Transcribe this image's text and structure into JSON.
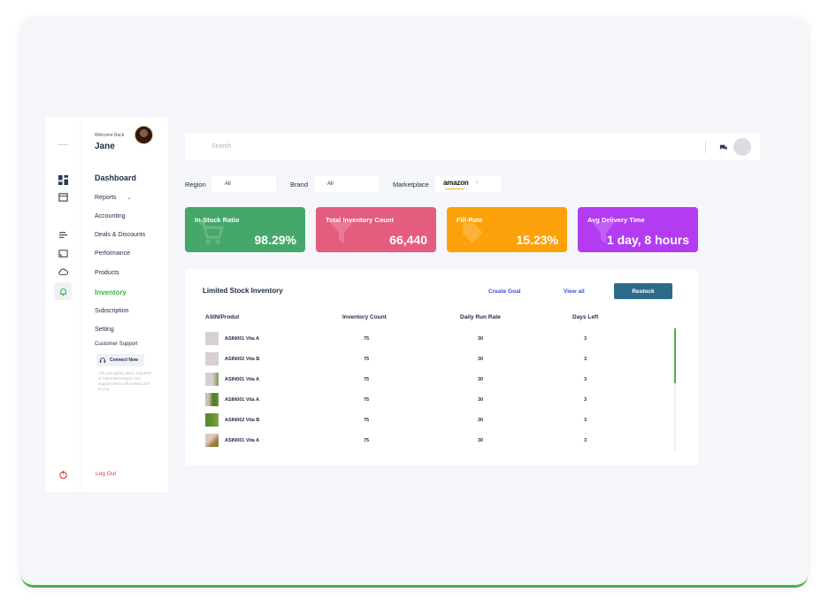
{
  "sidebar": {
    "welcome_text": "Welcome Back",
    "user_name": "Jane",
    "nav": {
      "dashboard": "Dashboard",
      "reports": "Reports",
      "accounting": "Accounting",
      "deals": "Deals & Discounts",
      "performance": "Performance",
      "products": "Products",
      "inventory": "Inventory",
      "subscription": "Subscription",
      "setting": "Setting"
    },
    "support": {
      "title": "Customer Support",
      "button": "Connect Now",
      "text": "Ask you query, place requests or important issues. Our support team will contact 24/7 to you."
    },
    "logout": "Log Out"
  },
  "header": {
    "search_placeholder": "Search"
  },
  "filters": {
    "region_label": "Region",
    "region_value": "All",
    "brand_label": "Brand",
    "brand_value": "All",
    "marketplace_label": "Marketplace",
    "marketplace_value": "amazon",
    "marketplace_clear": "×"
  },
  "kpis": [
    {
      "title": "In-Stock Ratio",
      "value": "98.29%",
      "color": "#45a86a"
    },
    {
      "title": "Total Inventory Count",
      "value": "66,440",
      "color": "#e45c7e"
    },
    {
      "title": "Fill-Rate",
      "value": "15.23%",
      "color": "#fca10a"
    },
    {
      "title": "Avg Delivery Time",
      "value": "1 day, 8 hours",
      "color": "#b33cf0"
    }
  ],
  "inventory_table": {
    "title": "Limited Stock Inventory",
    "create_goal": "Create Goal",
    "view_all": "View all",
    "restock": "Restock",
    "columns": [
      "ASIN/Produt",
      "Inventory Count",
      "Daily Run Rate",
      "Days Left"
    ],
    "rows": [
      {
        "name": "ASIN001 Vita A",
        "inventory": "75",
        "run_rate": "30",
        "days_left": "3"
      },
      {
        "name": "ASIN002 Vita B",
        "inventory": "75",
        "run_rate": "30",
        "days_left": "3"
      },
      {
        "name": "ASIN001 Vita A",
        "inventory": "75",
        "run_rate": "30",
        "days_left": "3"
      },
      {
        "name": "ASIN001 Vita A",
        "inventory": "75",
        "run_rate": "30",
        "days_left": "3"
      },
      {
        "name": "ASIN002 Vita B",
        "inventory": "75",
        "run_rate": "30",
        "days_left": "3"
      },
      {
        "name": "ASIN001 Vita A",
        "inventory": "75",
        "run_rate": "30",
        "days_left": "3"
      }
    ]
  },
  "colors": {
    "accent_green": "#3cb24a",
    "restock_button": "#2d6b8a",
    "link_blue": "#3a53d6",
    "logout_red": "#d93a3a"
  }
}
